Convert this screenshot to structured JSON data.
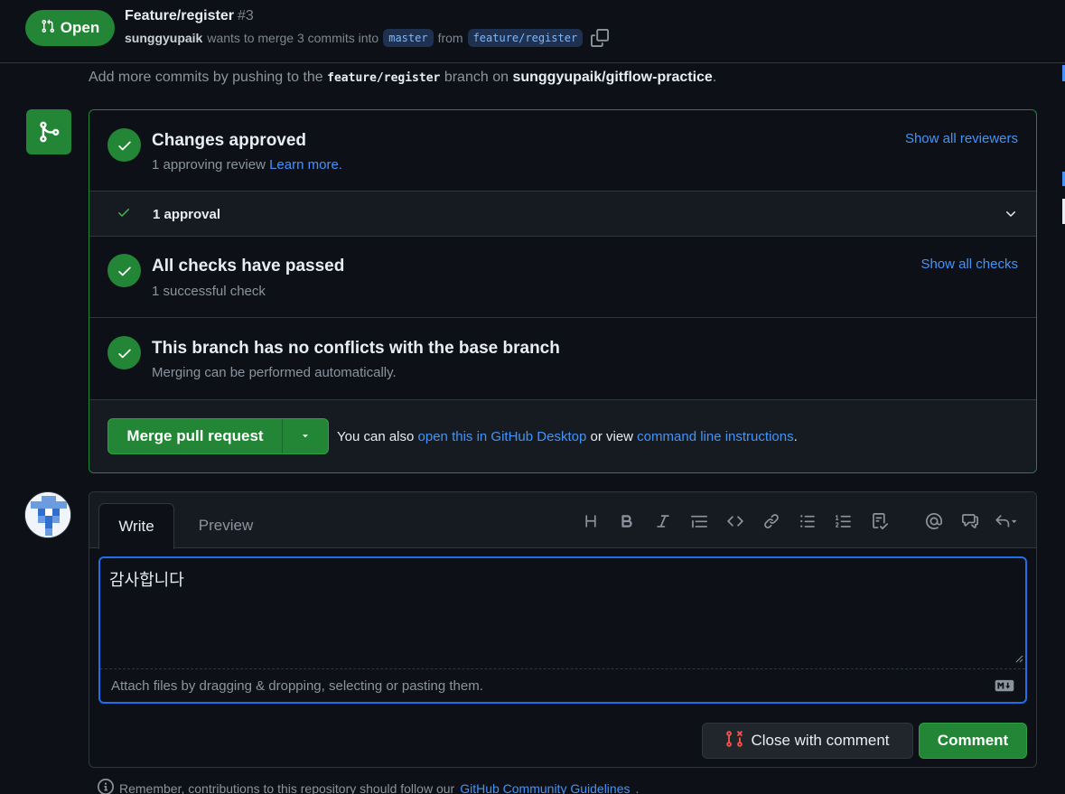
{
  "pr": {
    "state": "Open",
    "title": "Feature/register",
    "number": "#3",
    "author": "sunggyupaik",
    "merge_text": "wants to merge 3 commits into",
    "base_branch": "master",
    "from_text": "from",
    "head_branch": "feature/register"
  },
  "hint": {
    "prefix": "Add more commits by pushing to the",
    "branch": "feature/register",
    "middle": "branch on",
    "repo": "sunggyupaik/gitflow-practice",
    "suffix": "."
  },
  "merge_box": {
    "approved": {
      "title": "Changes approved",
      "sub": "1 approving review",
      "learn_more": "Learn more.",
      "link": "Show all reviewers"
    },
    "approval_row": {
      "label": "1 approval"
    },
    "checks": {
      "title": "All checks have passed",
      "sub": "1 successful check",
      "link": "Show all checks"
    },
    "conflicts": {
      "title": "This branch has no conflicts with the base branch",
      "sub": "Merging can be performed automatically."
    },
    "footer": {
      "merge_button": "Merge pull request",
      "also_text": "You can also",
      "desktop_link": "open this in GitHub Desktop",
      "or_view": "or view",
      "cli_link": "command line instructions",
      "period": "."
    }
  },
  "comment": {
    "tabs": {
      "write": "Write",
      "preview": "Preview"
    },
    "value": "감사합니다",
    "attach_text": "Attach files by dragging & dropping, selecting or pasting them.",
    "close_button": "Close with comment",
    "comment_button": "Comment"
  },
  "footer": {
    "text": "Remember, contributions to this repository should follow our",
    "link": "GitHub Community Guidelines",
    "period": "."
  },
  "colors": {
    "accent_green": "#238636",
    "link_blue": "#4493f8",
    "background": "#0d1117",
    "focus_blue": "#1f6feb"
  },
  "icons": {
    "state": "git-pull-request-icon",
    "copy": "copy-icon",
    "merge": "git-merge-icon",
    "check": "check-icon",
    "chevron": "chevron-down-icon",
    "close": "git-pull-request-closed-icon"
  }
}
